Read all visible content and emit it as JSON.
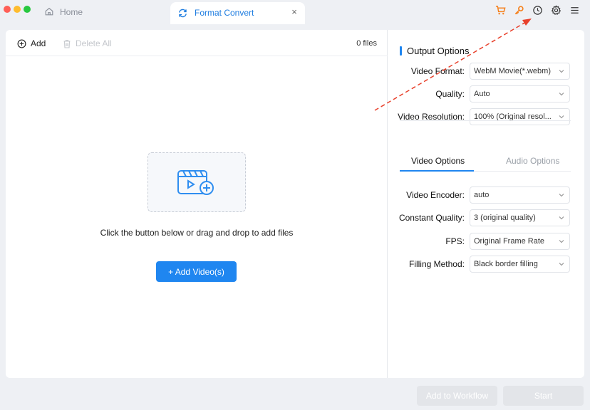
{
  "titlebar": {
    "home_label": "Home",
    "active_tab_label": "Format Convert",
    "close_glyph": "×",
    "icons": [
      "cart-icon",
      "key-icon",
      "clock-icon",
      "gear-icon",
      "menu-icon"
    ],
    "colors": {
      "cart": "#f5821f",
      "key": "#f5821f",
      "accent": "#1f7de0"
    }
  },
  "toolbar": {
    "add_label": "Add",
    "delete_all_label": "Delete All",
    "file_count": "0 files"
  },
  "drop": {
    "hint": "Click the button below or drag and drop to add files",
    "add_video_label": "+ Add Video(s)"
  },
  "output_options": {
    "title": "Output Options",
    "video_format": {
      "label": "Video Format:",
      "value": "WebM Movie(*.webm)"
    },
    "quality": {
      "label": "Quality:",
      "value": "Auto"
    },
    "video_resolution": {
      "label": "Video Resolution:",
      "value": "100% (Original resol..."
    }
  },
  "subtabs": {
    "video": "Video Options",
    "audio": "Audio Options"
  },
  "video_options": {
    "encoder": {
      "label": "Video Encoder:",
      "value": "auto"
    },
    "constant_quality": {
      "label": "Constant Quality:",
      "value": "3 (original quality)"
    },
    "fps": {
      "label": "FPS:",
      "value": "Original Frame Rate"
    },
    "filling_method": {
      "label": "Filling Method:",
      "value": "Black border filling"
    }
  },
  "footer": {
    "add_to_workflow": "Add to Workflow",
    "start": "Start"
  },
  "colors": {
    "primary": "#1f86f0",
    "disabled_button": "#e3e5e9",
    "annotation": "#e8412c"
  }
}
